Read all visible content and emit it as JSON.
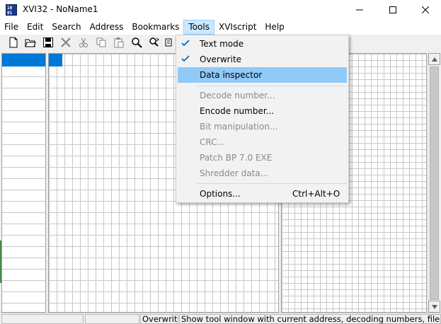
{
  "window": {
    "title": "XVI32 - NoName1"
  },
  "menubar": {
    "items": [
      "File",
      "Edit",
      "Search",
      "Address",
      "Bookmarks",
      "Tools",
      "XVIscript",
      "Help"
    ],
    "active": "Tools"
  },
  "tools_menu": {
    "text_mode": "Text mode",
    "overwrite": "Overwrite",
    "data_inspector": "Data inspector",
    "decode_number": "Decode number...",
    "encode_number": "Encode number...",
    "bit_manipulation": "Bit manipulation...",
    "crc": "CRC...",
    "patch_bp": "Patch BP 7.0 EXE",
    "shredder": "Shredder data...",
    "options": "Options...",
    "options_shortcut": "Ctrl+Alt+O"
  },
  "statusbar": {
    "mode": "Overwrite",
    "hint": "Show tool window with current address, decoding numbers, file siz"
  },
  "colors": {
    "selection": "#0078d7",
    "menu_highlight": "#91c9f7"
  }
}
